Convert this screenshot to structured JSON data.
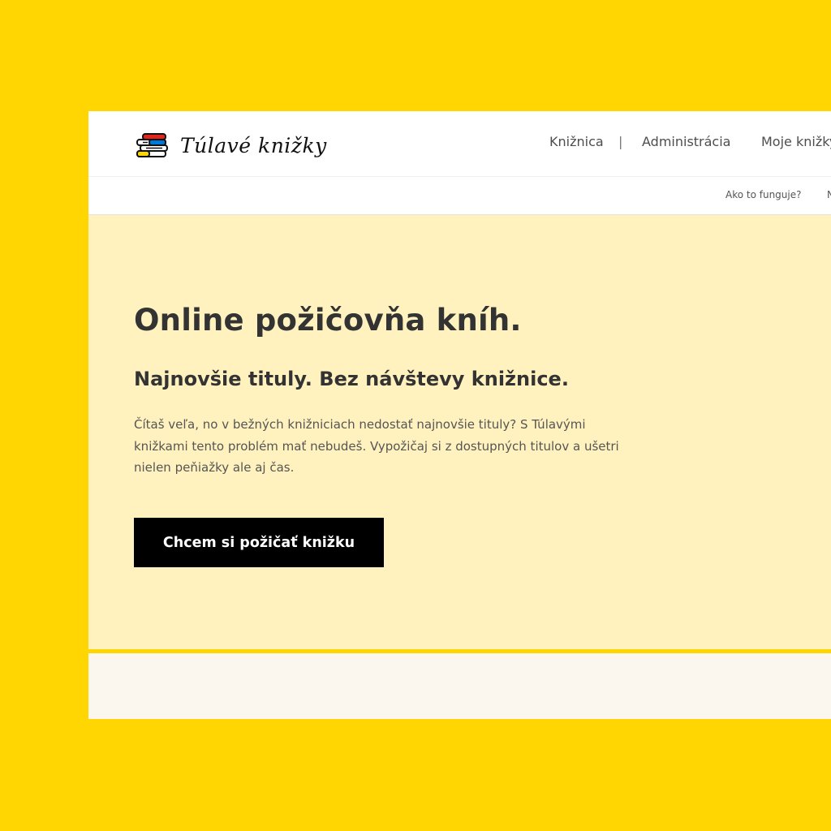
{
  "brand": {
    "name": "Túlavé knižky",
    "logo_colors": [
      "#E1251B",
      "#0078D7",
      "#FFD602"
    ]
  },
  "nav": {
    "items": [
      "Knižnica",
      "Administrácia",
      "Moje knižky"
    ],
    "separator": "|"
  },
  "subnav": {
    "items": [
      "Ako to funguje?",
      "N"
    ]
  },
  "hero": {
    "title": "Online požičovňa kníh.",
    "subtitle": "Najnovšie tituly. Bez návštevy knižnice.",
    "text": "Čítaš veľa, no v bežných knižniciach nedostať najnovšie tituly? S Túlavými knižkami tento problém mať nebudeš. Vypožičaj si z dostupných titulov a ušetri nielen peňiažky ale aj čas.",
    "cta_label": "Chcem si požičať knižku"
  },
  "colors": {
    "page_background": "#FFD602",
    "hero_background": "#FFF2BE",
    "lower_background": "#FBF7EE",
    "button_background": "#000000"
  }
}
